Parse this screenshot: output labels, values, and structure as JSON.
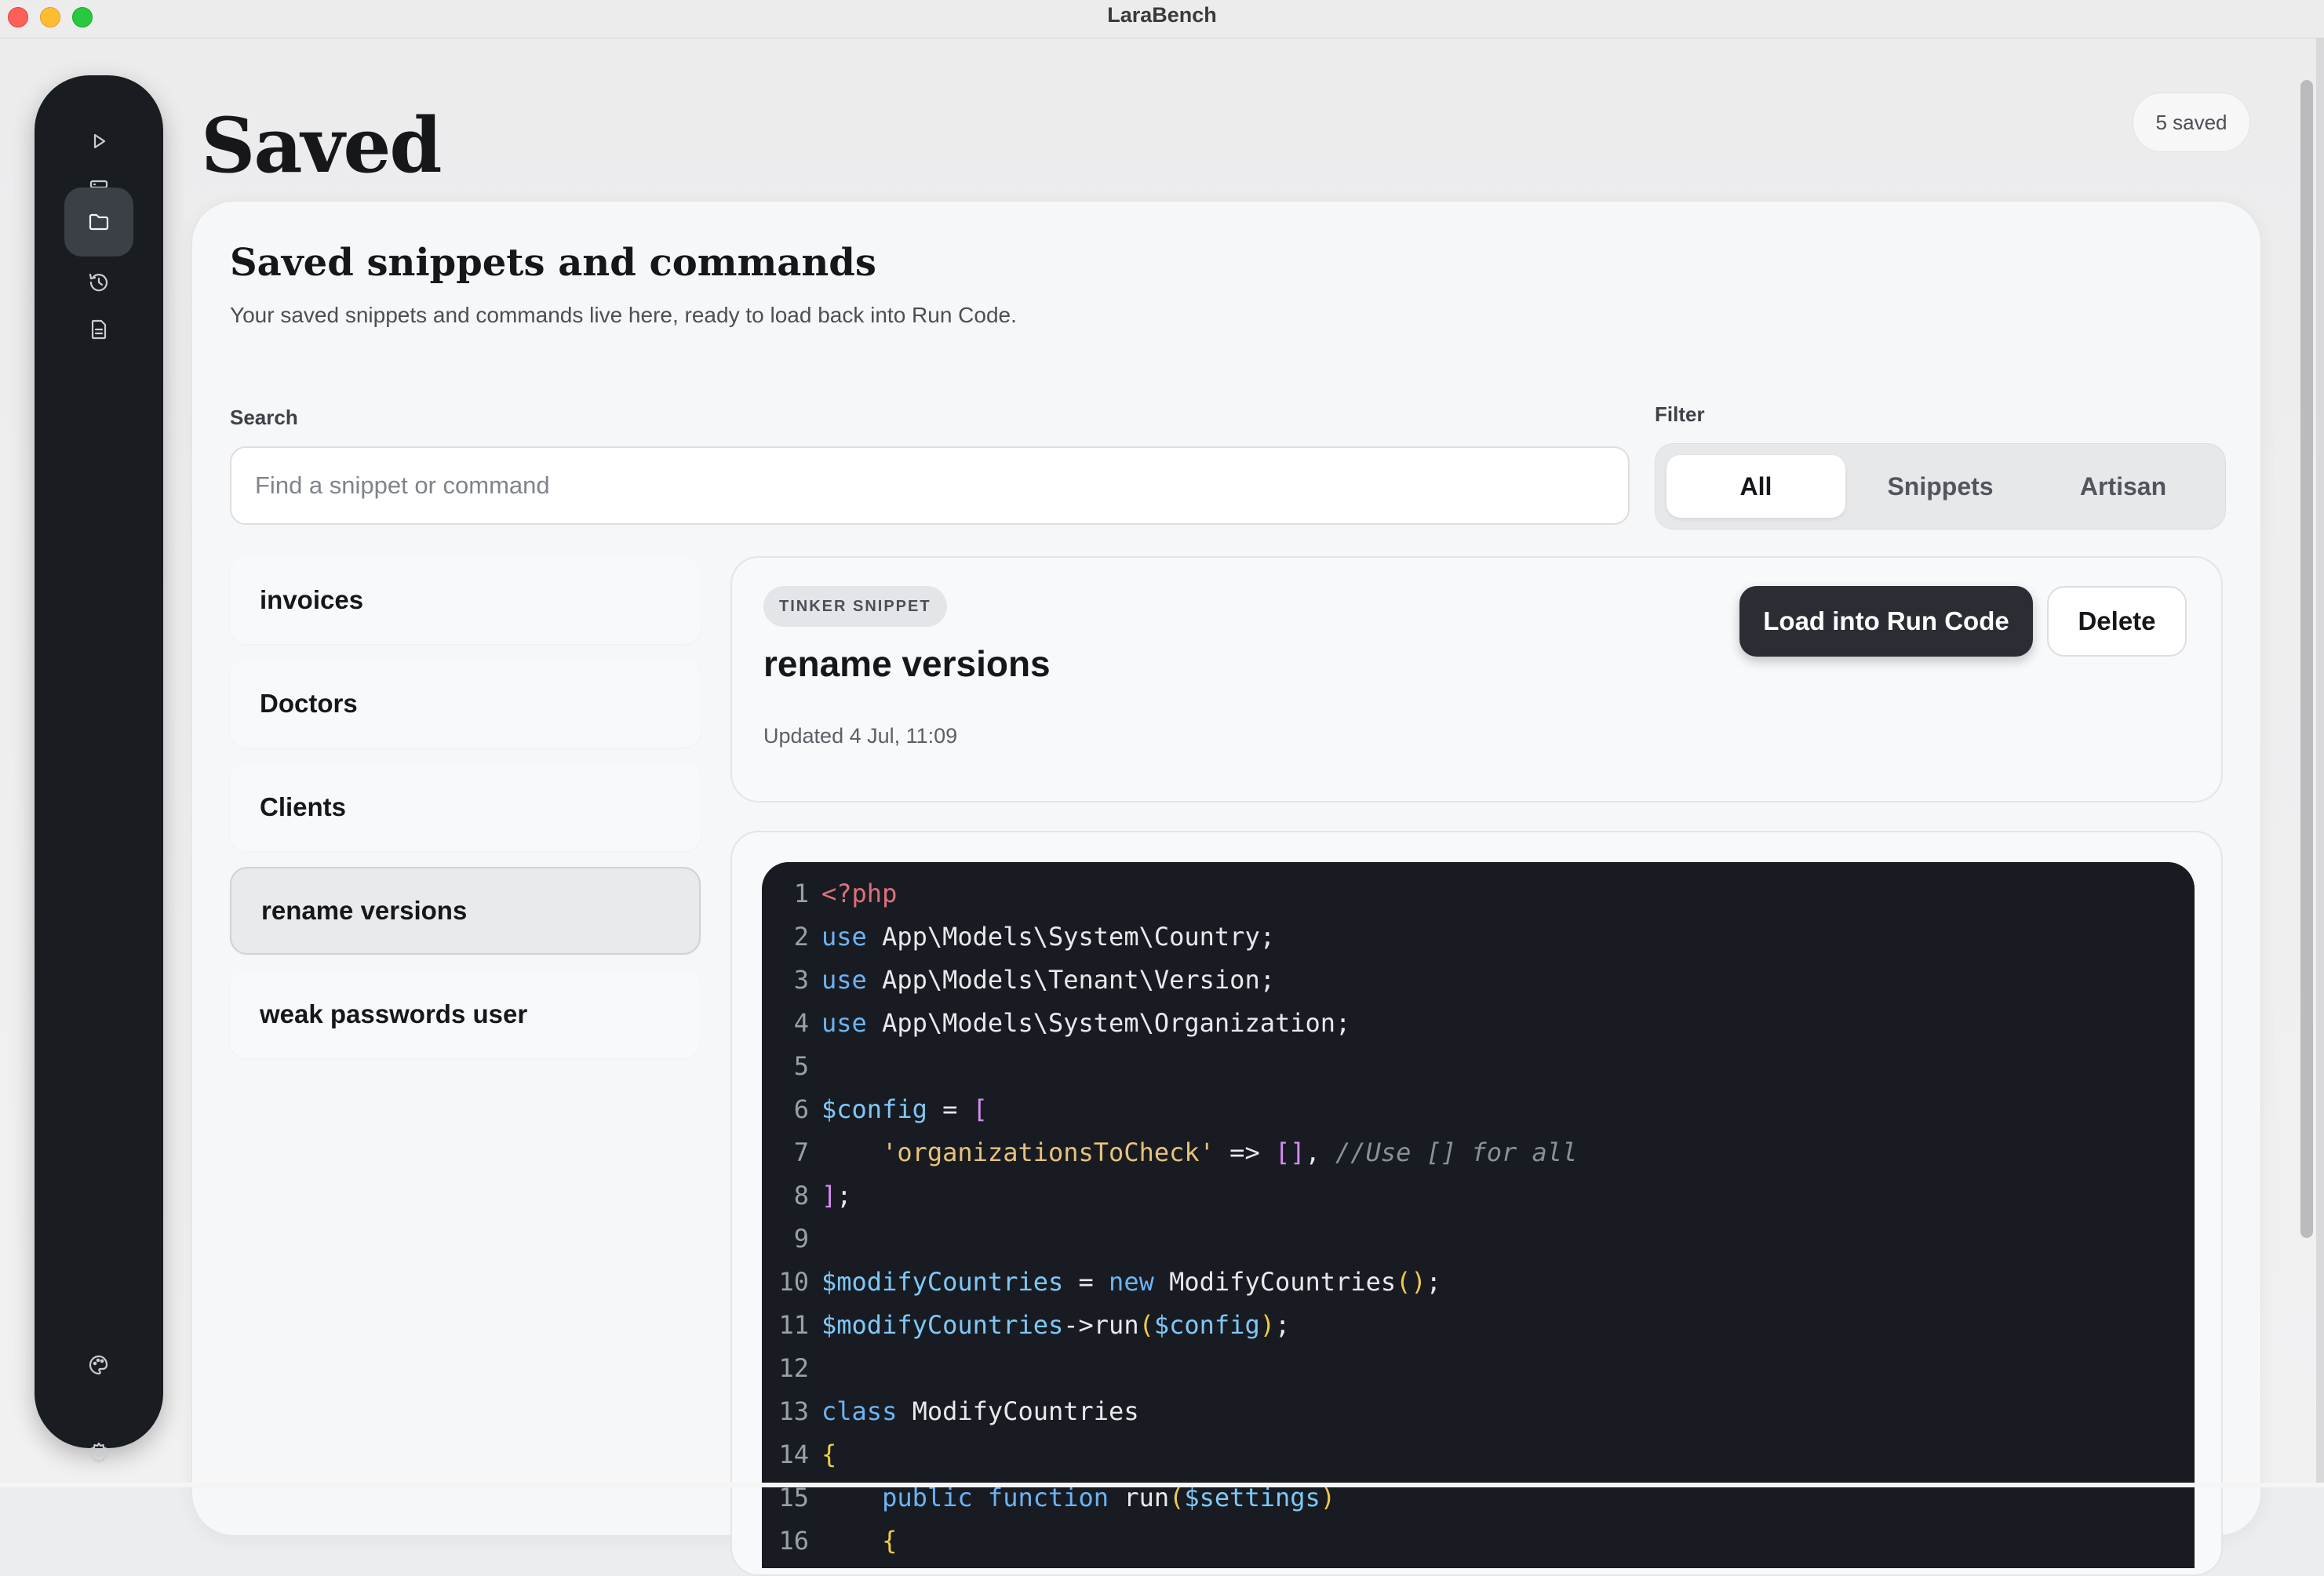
{
  "window": {
    "title": "LaraBench"
  },
  "sidebar": {
    "items": [
      {
        "name": "run",
        "icon": "play-icon",
        "active": false
      },
      {
        "name": "database",
        "icon": "database-icon",
        "active": false
      },
      {
        "name": "saved",
        "icon": "folder-icon",
        "active": true
      },
      {
        "name": "history",
        "icon": "history-icon",
        "active": false
      },
      {
        "name": "logs",
        "icon": "document-icon",
        "active": false
      },
      {
        "name": "theme",
        "icon": "palette-icon",
        "active": false
      },
      {
        "name": "settings",
        "icon": "gear-icon",
        "active": false
      }
    ]
  },
  "page": {
    "title": "Saved",
    "count_badge": "5 saved"
  },
  "card": {
    "heading": "Saved snippets and commands",
    "description": "Your saved snippets and commands live here, ready to load back into Run Code.",
    "search": {
      "label": "Search",
      "placeholder": "Find a snippet or command",
      "value": ""
    },
    "filter": {
      "label": "Filter",
      "options": [
        "All",
        "Snippets",
        "Artisan"
      ],
      "selected": "All"
    }
  },
  "saved_items": [
    "invoices",
    "Doctors",
    "Clients",
    "rename versions",
    "weak passwords user"
  ],
  "selected_item": "rename versions",
  "detail": {
    "tag": "TINKER SNIPPET",
    "title": "rename versions",
    "updated": "Updated 4 Jul, 11:09",
    "load_button": "Load into Run Code",
    "delete_button": "Delete"
  },
  "code": {
    "line_numbers": [
      "1",
      "2",
      "3",
      "4",
      "5",
      "6",
      "7",
      "8",
      "9",
      "10",
      "11",
      "12",
      "13",
      "14",
      "15",
      "16"
    ],
    "lines": [
      "<?php",
      "use App\\Models\\System\\Country;",
      "use App\\Models\\Tenant\\Version;",
      "use App\\Models\\System\\Organization;",
      "",
      "$config = [",
      "    'organizationsToCheck' => [], //Use [] for all",
      "];",
      "",
      "$modifyCountries = new ModifyCountries();",
      "$modifyCountries->run($config);",
      "",
      "class ModifyCountries",
      "{",
      "    public function run($settings)",
      "    {"
    ]
  },
  "colors": {
    "sidebar_bg": "#191c20",
    "code_bg": "#181c22",
    "primary_button": "#2a2e34",
    "keyword": "#6cb3f5",
    "string": "#e8c27b",
    "php_tag": "#e0707a"
  }
}
